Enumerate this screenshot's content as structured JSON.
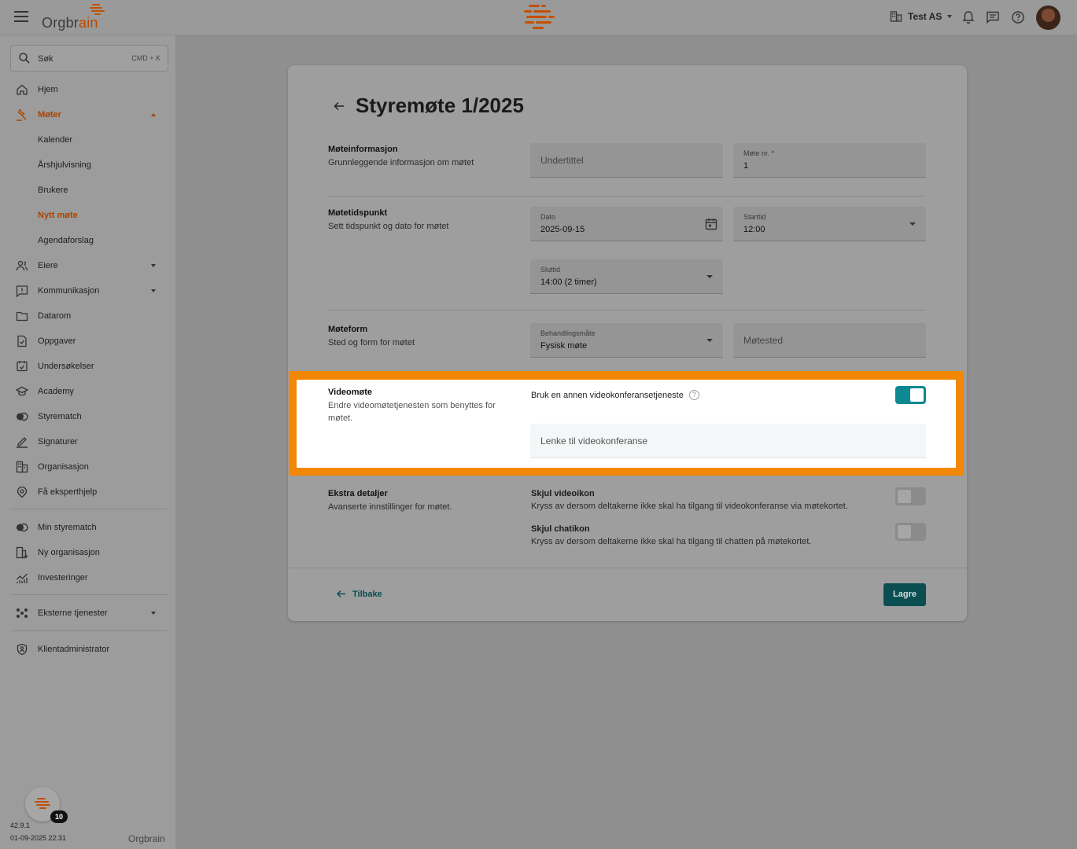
{
  "topbar": {
    "logo_text_a": "Orgbr",
    "logo_text_b": "ain",
    "org_name": "Test AS"
  },
  "sidebar": {
    "search_label": "Søk",
    "search_shortcut": "CMD + K",
    "items": [
      {
        "label": "Hjem",
        "icon": "home-icon"
      },
      {
        "label": "Møter",
        "icon": "gavel-icon"
      },
      {
        "label": "Kalender"
      },
      {
        "label": "Årshjulvisning"
      },
      {
        "label": "Brukere"
      },
      {
        "label": "Nytt møte"
      },
      {
        "label": "Agendaforslag"
      },
      {
        "label": "Eiere",
        "icon": "owners-icon"
      },
      {
        "label": "Kommunikasjon",
        "icon": "announcement-icon"
      },
      {
        "label": "Datarom",
        "icon": "folder-icon"
      },
      {
        "label": "Oppgaver",
        "icon": "task-icon"
      },
      {
        "label": "Undersøkelser",
        "icon": "survey-icon"
      },
      {
        "label": "Academy",
        "icon": "academy-icon"
      },
      {
        "label": "Styrematch",
        "icon": "styrematch-icon"
      },
      {
        "label": "Signaturer",
        "icon": "signature-icon"
      },
      {
        "label": "Organisasjon",
        "icon": "organization-icon"
      },
      {
        "label": "Få eksperthjelp",
        "icon": "expert-icon"
      },
      {
        "label": "Min styrematch",
        "icon": "styrematch-icon"
      },
      {
        "label": "Ny organisasjon",
        "icon": "add-organization-icon"
      },
      {
        "label": "Investeringer",
        "icon": "chart-icon"
      },
      {
        "label": "Eksterne tjenester",
        "icon": "services-icon"
      },
      {
        "label": "Klientadministrator",
        "icon": "shield-icon"
      }
    ],
    "version": "42.9.1",
    "datetime": "01-09-2025 22:31",
    "badge_count": "10",
    "footer_logo": "Orgbrain"
  },
  "page": {
    "title": "Styremøte 1/2025",
    "sections": {
      "info": {
        "title": "Møteinformasjon",
        "desc": "Grunnleggende informasjon om møtet"
      },
      "time": {
        "title": "Møtetidspunkt",
        "desc": "Sett tidspunkt og dato for møtet"
      },
      "form": {
        "title": "Møteform",
        "desc": "Sted og form for møtet"
      },
      "video": {
        "title": "Videomøte",
        "desc": "Endre videomøtetjenesten som benyttes for møtet."
      },
      "extra": {
        "title": "Ekstra detaljer",
        "desc": "Avanserte innstillinger for møtet."
      }
    },
    "fields": {
      "subtitle_placeholder": "Undertittel",
      "meeting_no_label": "Møte nr. *",
      "meeting_no_value": "1",
      "date_label": "Dato",
      "date_value": "2025-09-15",
      "start_label": "Starttid",
      "start_value": "12:00",
      "end_label": "Sluttid",
      "end_value": "14:00 (2 timer)",
      "mode_label": "Behandlingsmåte",
      "mode_value": "Fysisk møte",
      "location_placeholder": "Møtested",
      "video_toggle_label": "Bruk en annen videokonferansetjeneste",
      "video_toggle_on": true,
      "video_link_placeholder": "Lenke til videokonferanse"
    },
    "options": [
      {
        "title": "Skjul videoikon",
        "desc": "Kryss av dersom deltakerne ikke skal ha tilgang til videokonferanse via møtekortet.",
        "on": false
      },
      {
        "title": "Skjul chatikon",
        "desc": "Kryss av dersom deltakerne ikke skal ha tilgang til chatten på møtekortet.",
        "on": false
      }
    ],
    "back_label": "Tilbake",
    "save_label": "Lagre"
  },
  "colors": {
    "brand_orange": "#f28705",
    "teal": "#0e8991",
    "dark_teal": "#0a4e52"
  }
}
